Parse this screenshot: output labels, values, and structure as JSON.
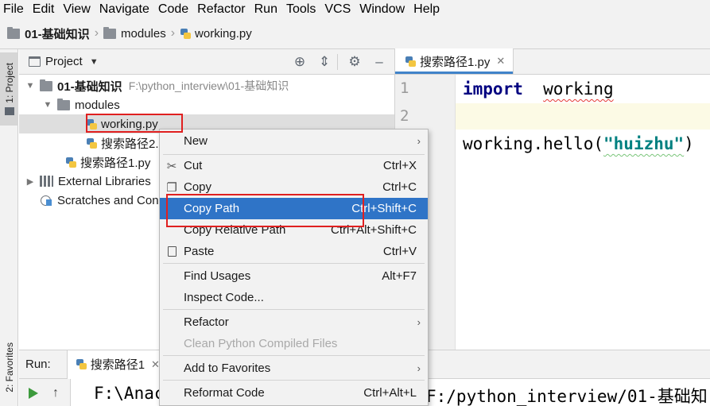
{
  "menu": [
    "File",
    "Edit",
    "View",
    "Navigate",
    "Code",
    "Refactor",
    "Run",
    "Tools",
    "VCS",
    "Window",
    "Help"
  ],
  "breadcrumb": {
    "project": "01-基础知识",
    "folder": "modules",
    "file": "working.py"
  },
  "toolwindows": {
    "project_tab": "1: Project",
    "favorites_tab": "2: Favorites"
  },
  "project_panel": {
    "title": "Project",
    "tree": {
      "root_name": "01-基础知识",
      "root_path": "F:\\python_interview\\01-基础知识",
      "modules": "modules",
      "working": "working.py",
      "search2": "搜索路径2.py",
      "search1": "搜索路径1.py",
      "external": "External Libraries",
      "scratches": "Scratches and Consoles"
    }
  },
  "editor": {
    "tab_name": "搜索路径1.py",
    "line_numbers": [
      "1",
      "2"
    ],
    "lines": {
      "l1_kw": "import",
      "l1_mod": "working",
      "l3_a": "working.hello(",
      "l3_str": "\"huizhu\"",
      "l3_b": ")"
    }
  },
  "run": {
    "label": "Run:",
    "tab_name": "搜索路径1",
    "output_left": "F:\\Anac",
    "output_right": "F:/python_interview/01-基础知"
  },
  "context_menu": {
    "new": "New",
    "cut": "Cut",
    "cut_sc": "Ctrl+X",
    "copy": "Copy",
    "copy_sc": "Ctrl+C",
    "copy_path": "Copy Path",
    "copy_path_sc": "Ctrl+Shift+C",
    "copy_rel": "Copy Relative Path",
    "copy_rel_sc": "Ctrl+Alt+Shift+C",
    "paste": "Paste",
    "paste_sc": "Ctrl+V",
    "find_usages": "Find Usages",
    "find_usages_sc": "Alt+F7",
    "inspect": "Inspect Code...",
    "refactor": "Refactor",
    "clean": "Clean Python Compiled Files",
    "add_fav": "Add to Favorites",
    "reformat": "Reformat Code",
    "reformat_sc": "Ctrl+Alt+L"
  },
  "colors": {
    "selection": "#2f74c7",
    "highlight_box": "#e02020",
    "keyword": "#000080",
    "string": "#008080"
  }
}
